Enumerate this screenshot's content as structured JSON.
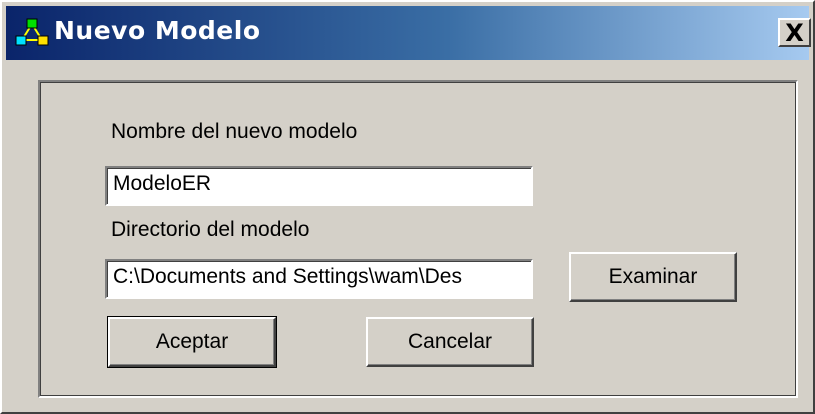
{
  "window": {
    "title": "Nuevo Modelo",
    "close_label": "✕",
    "close_glyph": "X"
  },
  "form": {
    "name_label": "Nombre del nuevo modelo",
    "name_value": "ModeloER",
    "dir_label": "Directorio del modelo",
    "dir_value": "C:\\Documents and Settings\\wam\\Des",
    "browse_label": "Examinar",
    "accept_label": "Aceptar",
    "cancel_label": "Cancelar"
  },
  "colors": {
    "titlebar_start": "#0a246a",
    "titlebar_end": "#a6caf0",
    "face": "#d4d0c8"
  },
  "icons": {
    "title_icon": "er-model-icon"
  }
}
